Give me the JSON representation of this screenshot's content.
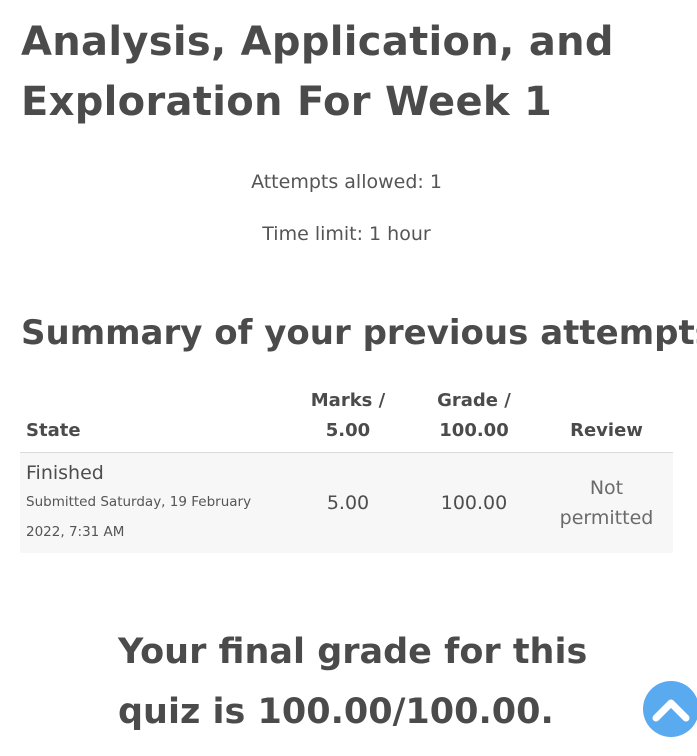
{
  "quiz": {
    "title": "Analysis, Application, and Exploration For Week 1",
    "attempts_allowed": "Attempts allowed: 1",
    "time_limit": "Time limit: 1 hour"
  },
  "summary": {
    "heading": "Summary of your previous attempts",
    "columns": {
      "state": "State",
      "marks": "Marks / 5.00",
      "grade": "Grade / 100.00",
      "review": "Review"
    },
    "rows": [
      {
        "state": "Finished",
        "submitted": "Submitted Saturday, 19 February 2022, 7:31 AM",
        "marks": "5.00",
        "grade": "100.00",
        "review": "Not permitted"
      }
    ]
  },
  "final_grade": "Your final grade for this quiz is 100.00/100.00.",
  "icons": {
    "back_to_top": "chevron-up-icon",
    "accent_color": "#5aaaf0"
  }
}
